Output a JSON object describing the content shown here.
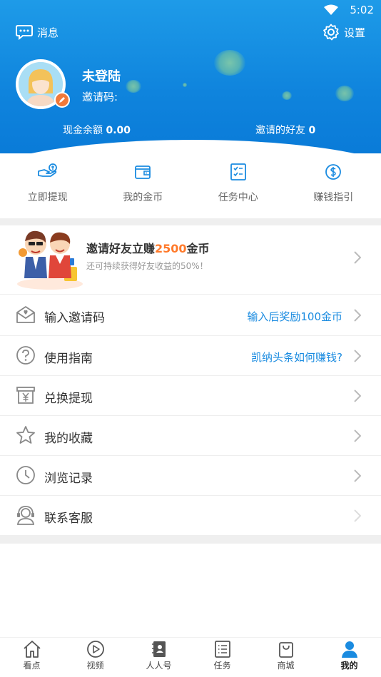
{
  "status_bar": {
    "time": "5:02"
  },
  "header": {
    "messages_label": "消息",
    "settings_label": "设置",
    "user_name": "未登陆",
    "invite_code_label": "邀请码:",
    "balance_label": "现金余额",
    "balance_value": "0.00",
    "friends_label": "邀请的好友",
    "friends_value": "0"
  },
  "quick_actions": [
    {
      "label": "立即提现",
      "icon": "withdraw-hand-coin-icon"
    },
    {
      "label": "我的金币",
      "icon": "wallet-icon"
    },
    {
      "label": "任务中心",
      "icon": "task-checklist-icon"
    },
    {
      "label": "赚钱指引",
      "icon": "dollar-circle-icon"
    }
  ],
  "banner": {
    "title_prefix": "邀请好友立赚",
    "title_amount": "2500",
    "title_suffix": "金币",
    "subtitle": "还可持续获得好友收益的50%！"
  },
  "menu": [
    {
      "label": "输入邀请码",
      "hint": "输入后奖励100金币",
      "icon": "envelope-heart-icon"
    },
    {
      "label": "使用指南",
      "hint": "凯纳头条如何赚钱?",
      "icon": "question-circle-icon"
    },
    {
      "label": "兑换提现",
      "hint": "",
      "icon": "yuan-box-icon"
    },
    {
      "label": "我的收藏",
      "hint": "",
      "icon": "star-icon"
    },
    {
      "label": "浏览记录",
      "hint": "",
      "icon": "clock-icon"
    },
    {
      "label": "联系客服",
      "hint": "",
      "icon": "headset-agent-icon"
    }
  ],
  "bottom_nav": [
    {
      "label": "看点",
      "icon": "home-icon",
      "active": false
    },
    {
      "label": "视频",
      "icon": "play-circle-icon",
      "active": false
    },
    {
      "label": "人人号",
      "icon": "contacts-book-icon",
      "active": false
    },
    {
      "label": "任务",
      "icon": "list-icon",
      "active": false
    },
    {
      "label": "商城",
      "icon": "shopping-bag-icon",
      "active": false
    },
    {
      "label": "我的",
      "icon": "person-icon",
      "active": true
    }
  ],
  "colors": {
    "header_blue": "#1190e0",
    "accent_orange": "#ff7a2b",
    "hint_blue": "#1a8be0",
    "active_nav": "#1a8be0"
  }
}
